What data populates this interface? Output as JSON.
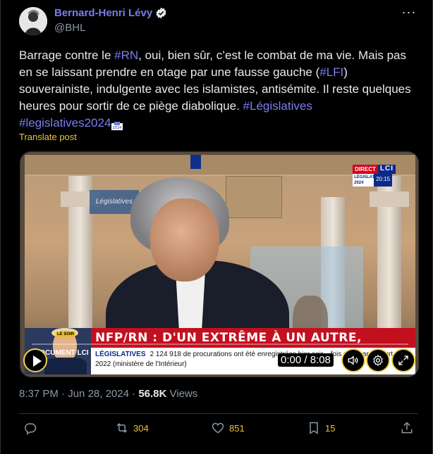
{
  "author": {
    "name": "Bernard-Henri Lévy",
    "handle": "@BHL"
  },
  "post": {
    "text_1": "Barrage contre le ",
    "tag_rn": "#RN",
    "text_2": ", oui, bien sûr, c’est le combat de ma vie. Mais pas en se laissant prendre en otage par une fausse gauche (",
    "tag_lfi": "#LFI",
    "text_3": ") souverainiste, indulgente avec les islamistes, antisémite. Il reste quelques heures pour sortir de ce piège diabolique. ",
    "tag_leg": "#Législatives",
    "tag_leg2024": "#legislatives2024",
    "translate_label": "Translate post"
  },
  "video": {
    "channel_direct": "DIRECT",
    "channel_name": "LCI",
    "channel_legend": "LÉGISLATIVES 2024",
    "channel_time": "20:15",
    "banner_text": "NFP/RN : D'UN EXTRÊME À UN AUTRE, VRAIMENT ?",
    "ticker_label": "LÉGISLATIVES",
    "ticker_text": "2 124 918 de procurations ont été enregistrées hier soir... fois plus par rapport à 2022 (ministère de l'Intérieur)",
    "inset_doc": "DOCUMENT LCI",
    "inset_label": "LE SOIR",
    "panel_text": "Législatives",
    "timecode": "0:00 / 8:08"
  },
  "meta": {
    "time": "8:37 PM",
    "separator": " · ",
    "date": "Jun 28, 2024",
    "views_count": "56.8K",
    "views_label": " Views"
  },
  "actions": {
    "replies": "",
    "reposts": "304",
    "likes": "851",
    "bookmarks": "15"
  },
  "colors": {
    "accent": "#7c7cf0",
    "highlight": "#e8c542",
    "muted": "#8b98a5",
    "banner_red": "#c3101f"
  }
}
